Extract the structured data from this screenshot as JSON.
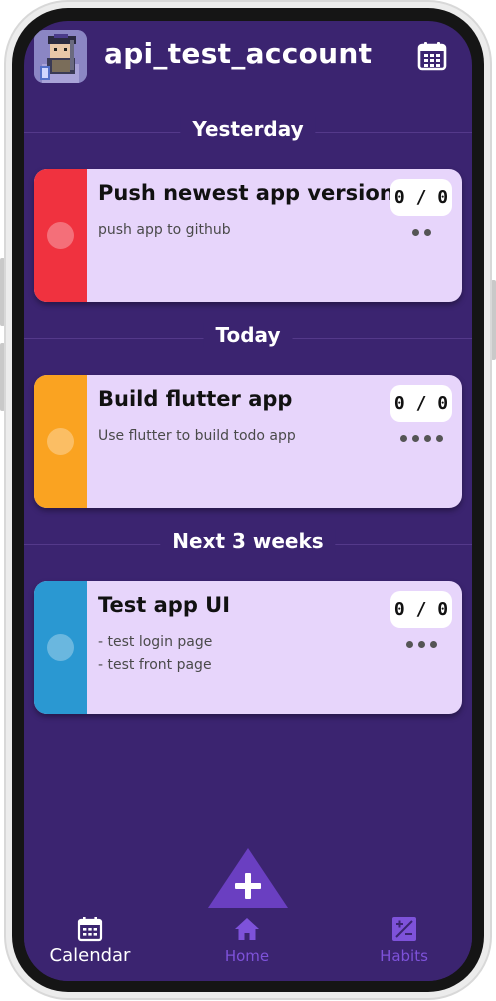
{
  "header": {
    "title": "api_test_account",
    "avatar_icon": "pixel-character-avatar-icon",
    "calendar_icon": "calendar-icon"
  },
  "sections": [
    {
      "label": "Yesterday",
      "tasks": [
        {
          "title": "Push newest app version",
          "description": "push app to github",
          "count": "0 / 0",
          "dots": 2,
          "color": "#f0323f"
        }
      ]
    },
    {
      "label": "Today",
      "tasks": [
        {
          "title": "Build flutter app",
          "description": "Use flutter to build todo app",
          "count": "0 / 0",
          "dots": 4,
          "color": "#faa321"
        }
      ]
    },
    {
      "label": "Next 3 weeks",
      "tasks": [
        {
          "title": "Test app UI",
          "description": "- test login page\n- test front page",
          "count": "0 / 0",
          "dots": 3,
          "color": "#2a98d2"
        }
      ]
    }
  ],
  "fab": {
    "icon": "plus-icon",
    "color": "#6a3fc1"
  },
  "bottom_nav": {
    "items": [
      {
        "label": "Calendar",
        "icon": "calendar-icon",
        "active": true
      },
      {
        "label": "Home",
        "icon": "home-icon",
        "active": false
      },
      {
        "label": "Habits",
        "icon": "habits-icon",
        "active": false
      }
    ]
  },
  "colors": {
    "background": "#3b2470",
    "card": "#e7d5fb",
    "accent": "#7e52da"
  }
}
